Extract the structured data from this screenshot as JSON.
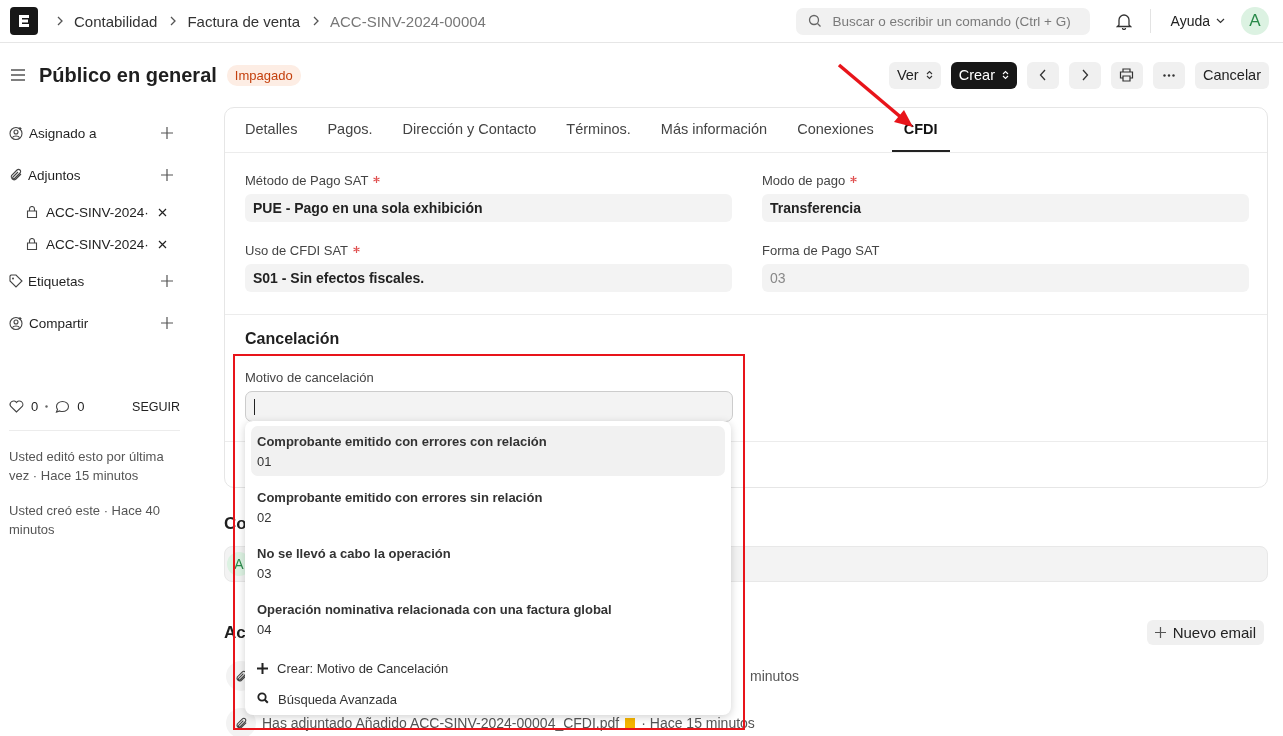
{
  "breadcrumbs": [
    {
      "label": "Contabilidad",
      "current": false
    },
    {
      "label": "Factura de venta",
      "current": false
    },
    {
      "label": "ACC-SINV-2024-00004",
      "current": true
    }
  ],
  "search": {
    "placeholder": "Buscar o escribir un comando (Ctrl + G)"
  },
  "help_menu": "Ayuda",
  "user_avatar": "A",
  "title": "Público en general",
  "status": "Impagado",
  "actions": [
    {
      "kind": "select",
      "label": "Ver"
    },
    {
      "kind": "primary",
      "label": "Crear"
    },
    {
      "kind": "prev"
    },
    {
      "kind": "next"
    },
    {
      "kind": "print"
    },
    {
      "kind": "more"
    },
    {
      "kind": "plain",
      "label": "Cancelar"
    }
  ],
  "sidebar": {
    "sections": [
      {
        "kind": "assign",
        "label": "Asignado a"
      },
      {
        "kind": "attachments",
        "label": "Adjuntos",
        "attachments": [
          "ACC-SINV-2024·",
          "ACC-SINV-2024·"
        ]
      },
      {
        "kind": "tags",
        "label": "Etiquetas"
      },
      {
        "kind": "share",
        "label": "Compartir"
      }
    ],
    "likes": "0",
    "comments": "0",
    "follow": "SEGUIR",
    "history": [
      "Usted editó esto por última vez · Hace 15 minutos",
      "Usted creó este · Hace 40 minutos"
    ]
  },
  "tabs": [
    {
      "label": "Detalles",
      "selected": false
    },
    {
      "label": "Pagos.",
      "selected": false
    },
    {
      "label": "Dirección y Contacto",
      "selected": false
    },
    {
      "label": "Términos.",
      "selected": false
    },
    {
      "label": "Más información",
      "selected": false
    },
    {
      "label": "Conexiones",
      "selected": false
    },
    {
      "label": "CFDI",
      "selected": true
    }
  ],
  "fields": [
    {
      "label": "Método de Pago SAT",
      "required": true,
      "value": "PUE - Pago en una sola exhibición",
      "disabled": false
    },
    {
      "label": "Modo de pago",
      "required": true,
      "value": "Transferencia",
      "disabled": false
    },
    {
      "label": "Uso de CFDI SAT",
      "required": true,
      "value": "S01 - Sin efectos fiscales.",
      "disabled": false
    },
    {
      "label": "Forma de Pago SAT",
      "required": false,
      "value": "03",
      "disabled": true
    }
  ],
  "cancel_section": {
    "heading": "Cancelación",
    "field_label": "Motivo de cancelación"
  },
  "dropdown": {
    "options": [
      {
        "title": "Comprobante emitido con errores con relación",
        "code": "01",
        "selected": true
      },
      {
        "title": "Comprobante emitido con errores sin relación",
        "code": "02",
        "selected": false
      },
      {
        "title": "No se llevó a cabo la operación",
        "code": "03",
        "selected": false
      },
      {
        "title": "Operación nominativa relacionada con una factura global",
        "code": "04",
        "selected": false
      }
    ],
    "actions": [
      {
        "kind": "create",
        "label": "Crear: Motivo de Cancelación"
      },
      {
        "kind": "search",
        "label": "Búsqueda Avanzada"
      }
    ]
  },
  "comments": {
    "heading": "Co",
    "avatar": "A"
  },
  "activity": {
    "heading": "Ac",
    "new_email": "Nuevo email",
    "rows": [
      {
        "kind": "partial",
        "text": "minutos"
      },
      {
        "kind": "full",
        "text": "Has adjuntado Añadido ACC-SINV-2024-00004_CFDI.pdf",
        "after": "· Hace 15 minutos"
      }
    ]
  }
}
